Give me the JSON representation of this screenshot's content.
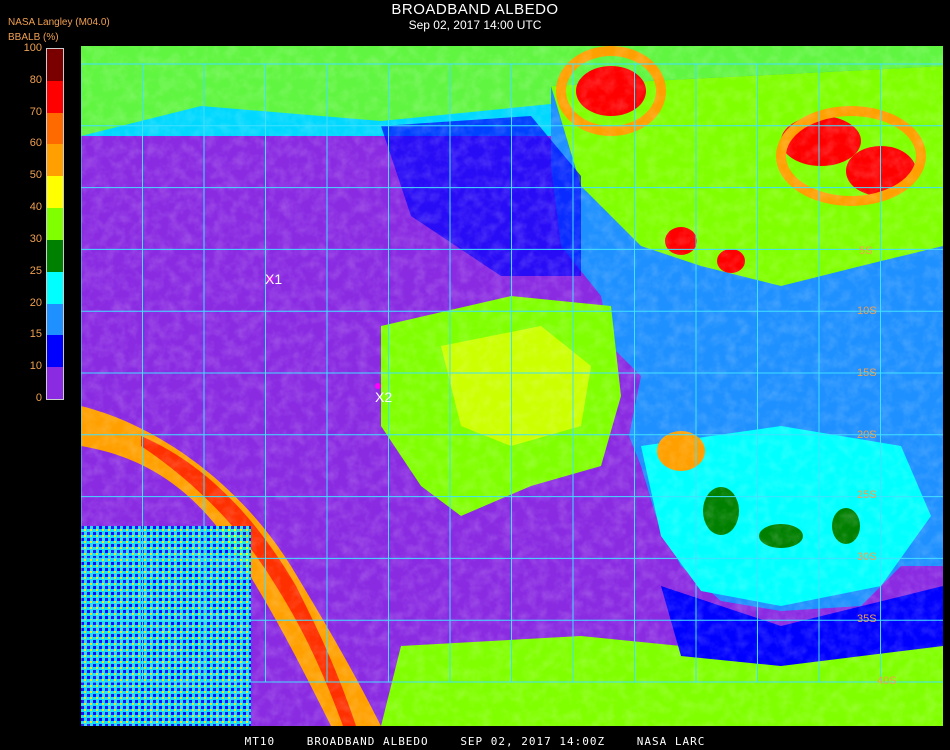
{
  "title": "BROADBAND ALBEDO",
  "subtitle": "Sep 02, 2017 14:00 UTC",
  "source_label": "NASA Langley (M04.0)",
  "unit_label": "BBALB (%)",
  "colorbar": {
    "ticks": [
      "100",
      "80",
      "70",
      "60",
      "50",
      "40",
      "30",
      "25",
      "20",
      "15",
      "10",
      "0"
    ],
    "colors": [
      "#7a0000",
      "#ff0000",
      "#ff6a00",
      "#ffa000",
      "#ffff00",
      "#80ff00",
      "#008000",
      "#00ffff",
      "#1e90ff",
      "#0000ff",
      "#8a2be2"
    ]
  },
  "markers": [
    {
      "label": "X1"
    },
    {
      "label": "X2"
    }
  ],
  "grid_labels": [
    "5S",
    "10S",
    "15S",
    "20S",
    "25S",
    "30S",
    "35S",
    "40S"
  ],
  "footer": {
    "product": "MT10",
    "name": "BROADBAND ALBEDO",
    "date": "SEP 02, 2017 14:00Z",
    "org": "NASA LARC"
  },
  "colors": {
    "ocean_clear": "#8a2be2",
    "land_clear": "#00ffff",
    "grid": "#40e0ff",
    "label": "#f0a050"
  }
}
